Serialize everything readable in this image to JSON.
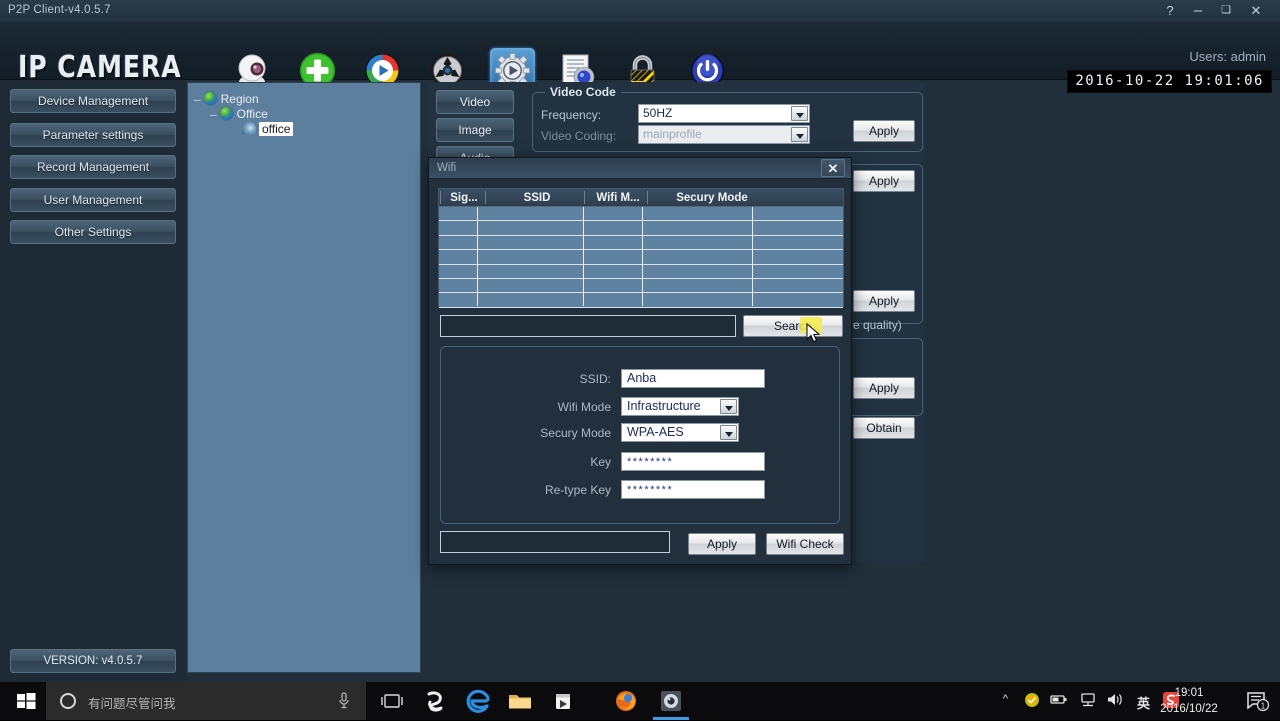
{
  "window": {
    "title": "P2P Client-v4.0.5.7",
    "help_label": "?",
    "minimize_label": "–",
    "maximize_label": "❑",
    "close_label": "✕"
  },
  "header": {
    "logo": "IP CAMERA",
    "user_label": "Users: admin",
    "timestamp": "2016-10-22 19:01:06",
    "toolbar": [
      {
        "name": "camera-icon",
        "selected": false
      },
      {
        "name": "add-device-icon",
        "selected": false
      },
      {
        "name": "playback-icon",
        "selected": false
      },
      {
        "name": "record-wheel-icon",
        "selected": false
      },
      {
        "name": "settings-gear-icon",
        "selected": true
      },
      {
        "name": "config-document-icon",
        "selected": false
      },
      {
        "name": "lock-icon",
        "selected": false
      },
      {
        "name": "power-icon",
        "selected": false
      }
    ]
  },
  "sidebar": {
    "items": [
      {
        "label": "Device Management"
      },
      {
        "label": "Parameter settings"
      },
      {
        "label": "Record Management"
      },
      {
        "label": "User Management"
      },
      {
        "label": "Other Settings"
      }
    ],
    "version_label": "VERSION: v4.0.5.7"
  },
  "tree": {
    "nodes": [
      {
        "label": "Region",
        "expander": "–"
      },
      {
        "label": "Office",
        "expander": "–"
      },
      {
        "label": "office",
        "expander": ""
      }
    ]
  },
  "main": {
    "tabs": [
      {
        "label": "Video"
      },
      {
        "label": "Image"
      },
      {
        "label": "Audio"
      }
    ],
    "video_code": {
      "title": "Video Code",
      "frequency_label": "Frequency:",
      "frequency_value": "50HZ",
      "coding_label": "Video Coding:",
      "coding_value": "mainprofile",
      "apply_label": "Apply"
    },
    "apply_label": "Apply",
    "obtain_label": "Obtain",
    "quality_hint": "e quality)"
  },
  "wifi_dialog": {
    "title": "Wifi",
    "close_label": "✕",
    "table": {
      "columns": [
        "Sig...",
        "SSID",
        "Wifi M...",
        "Secury Mode",
        ""
      ],
      "rows": []
    },
    "search_field_value": "",
    "search_button": "Search",
    "form": {
      "ssid_label": "SSID:",
      "ssid_value": "Anba",
      "wifi_mode_label": "Wifi Mode",
      "wifi_mode_value": "Infrastructure",
      "security_mode_label": "Secury Mode",
      "security_mode_value": "WPA-AES",
      "key_label": "Key",
      "key_value": "********",
      "retype_key_label": "Re-type Key",
      "retype_key_value": "********"
    },
    "bottom_field_value": "",
    "apply_button": "Apply",
    "wifi_check_button": "Wifi Check"
  },
  "taskbar": {
    "start_name": "start-button",
    "search_placeholder": "有问题尽管问我",
    "apps": [
      "task-view-icon",
      "sogou-icon",
      "edge-icon",
      "file-explorer-icon",
      "store-icon",
      "firefox-icon",
      "p2p-client-icon"
    ],
    "tray": {
      "ime_label": "英",
      "sogou_label": "S",
      "time": "19:01",
      "date": "2016/10/22",
      "notification_count": "1"
    }
  },
  "colors": {
    "accent": "#3d9ae2",
    "panel": "#223240",
    "tree_panel": "#5c7f9d",
    "button_face": "#e6e8ea"
  }
}
